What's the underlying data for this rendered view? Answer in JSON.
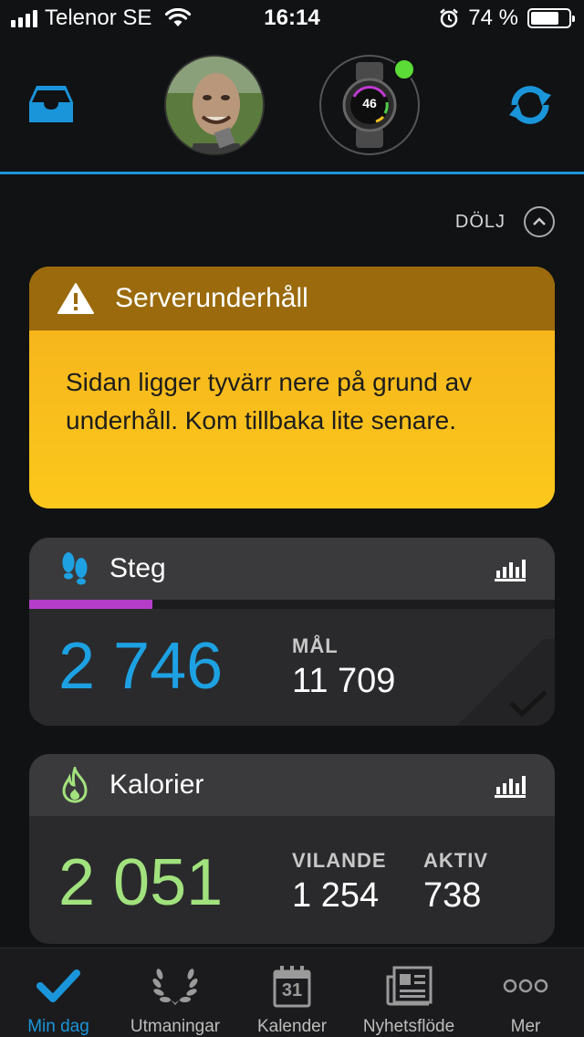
{
  "status_bar": {
    "carrier": "Telenor SE",
    "time": "16:14",
    "battery_text": "74 %",
    "battery_level": 0.74
  },
  "header": {
    "watch_display": "46",
    "watch_connected_color": "#5cdc37",
    "accent_color": "#1a95d9"
  },
  "hide_label": "DÖLJ",
  "alert": {
    "title": "Serverunderhåll",
    "message": "Sidan ligger tyvärr nere på grund av underhåll. Kom tillbaka lite senare.",
    "icon": "warning-icon"
  },
  "steps_card": {
    "title": "Steg",
    "icon": "footprints-icon",
    "value": "2 746",
    "goal_label": "MÅL",
    "goal_value": "11 709",
    "progress": 0.235,
    "value_color": "#1da1e2",
    "progress_color": "#b53ec9"
  },
  "calories_card": {
    "title": "Kalorier",
    "icon": "flame-icon",
    "value": "2 051",
    "resting_label": "VILANDE",
    "resting_value": "1 254",
    "active_label": "AKTIV",
    "active_value": "738",
    "value_color": "#a2e27e"
  },
  "tabs": [
    {
      "label": "Min dag",
      "icon": "checkmark-icon",
      "active": true
    },
    {
      "label": "Utmaningar",
      "icon": "laurel-icon",
      "active": false
    },
    {
      "label": "Kalender",
      "icon": "calendar-icon",
      "day": "31",
      "active": false
    },
    {
      "label": "Nyhetsflöde",
      "icon": "newsfeed-icon",
      "active": false
    },
    {
      "label": "Mer",
      "icon": "more-icon",
      "active": false
    }
  ]
}
